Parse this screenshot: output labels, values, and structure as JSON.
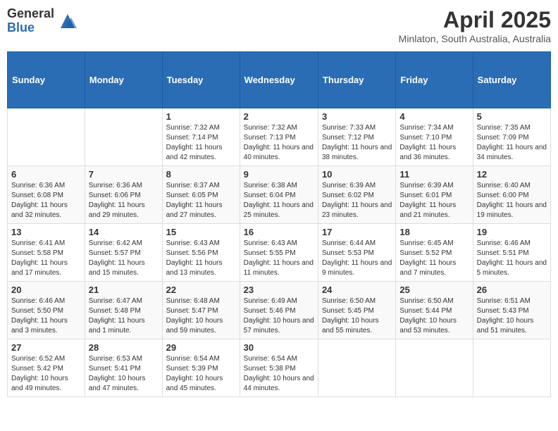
{
  "header": {
    "logo_general": "General",
    "logo_blue": "Blue",
    "title": "April 2025",
    "location": "Minlaton, South Australia, Australia"
  },
  "days_of_week": [
    "Sunday",
    "Monday",
    "Tuesday",
    "Wednesday",
    "Thursday",
    "Friday",
    "Saturday"
  ],
  "weeks": [
    [
      {
        "day": "",
        "sunrise": "",
        "sunset": "",
        "daylight": ""
      },
      {
        "day": "",
        "sunrise": "",
        "sunset": "",
        "daylight": ""
      },
      {
        "day": "1",
        "sunrise": "Sunrise: 7:32 AM",
        "sunset": "Sunset: 7:14 PM",
        "daylight": "Daylight: 11 hours and 42 minutes."
      },
      {
        "day": "2",
        "sunrise": "Sunrise: 7:32 AM",
        "sunset": "Sunset: 7:13 PM",
        "daylight": "Daylight: 11 hours and 40 minutes."
      },
      {
        "day": "3",
        "sunrise": "Sunrise: 7:33 AM",
        "sunset": "Sunset: 7:12 PM",
        "daylight": "Daylight: 11 hours and 38 minutes."
      },
      {
        "day": "4",
        "sunrise": "Sunrise: 7:34 AM",
        "sunset": "Sunset: 7:10 PM",
        "daylight": "Daylight: 11 hours and 36 minutes."
      },
      {
        "day": "5",
        "sunrise": "Sunrise: 7:35 AM",
        "sunset": "Sunset: 7:09 PM",
        "daylight": "Daylight: 11 hours and 34 minutes."
      }
    ],
    [
      {
        "day": "6",
        "sunrise": "Sunrise: 6:36 AM",
        "sunset": "Sunset: 6:08 PM",
        "daylight": "Daylight: 11 hours and 32 minutes."
      },
      {
        "day": "7",
        "sunrise": "Sunrise: 6:36 AM",
        "sunset": "Sunset: 6:06 PM",
        "daylight": "Daylight: 11 hours and 29 minutes."
      },
      {
        "day": "8",
        "sunrise": "Sunrise: 6:37 AM",
        "sunset": "Sunset: 6:05 PM",
        "daylight": "Daylight: 11 hours and 27 minutes."
      },
      {
        "day": "9",
        "sunrise": "Sunrise: 6:38 AM",
        "sunset": "Sunset: 6:04 PM",
        "daylight": "Daylight: 11 hours and 25 minutes."
      },
      {
        "day": "10",
        "sunrise": "Sunrise: 6:39 AM",
        "sunset": "Sunset: 6:02 PM",
        "daylight": "Daylight: 11 hours and 23 minutes."
      },
      {
        "day": "11",
        "sunrise": "Sunrise: 6:39 AM",
        "sunset": "Sunset: 6:01 PM",
        "daylight": "Daylight: 11 hours and 21 minutes."
      },
      {
        "day": "12",
        "sunrise": "Sunrise: 6:40 AM",
        "sunset": "Sunset: 6:00 PM",
        "daylight": "Daylight: 11 hours and 19 minutes."
      }
    ],
    [
      {
        "day": "13",
        "sunrise": "Sunrise: 6:41 AM",
        "sunset": "Sunset: 5:58 PM",
        "daylight": "Daylight: 11 hours and 17 minutes."
      },
      {
        "day": "14",
        "sunrise": "Sunrise: 6:42 AM",
        "sunset": "Sunset: 5:57 PM",
        "daylight": "Daylight: 11 hours and 15 minutes."
      },
      {
        "day": "15",
        "sunrise": "Sunrise: 6:43 AM",
        "sunset": "Sunset: 5:56 PM",
        "daylight": "Daylight: 11 hours and 13 minutes."
      },
      {
        "day": "16",
        "sunrise": "Sunrise: 6:43 AM",
        "sunset": "Sunset: 5:55 PM",
        "daylight": "Daylight: 11 hours and 11 minutes."
      },
      {
        "day": "17",
        "sunrise": "Sunrise: 6:44 AM",
        "sunset": "Sunset: 5:53 PM",
        "daylight": "Daylight: 11 hours and 9 minutes."
      },
      {
        "day": "18",
        "sunrise": "Sunrise: 6:45 AM",
        "sunset": "Sunset: 5:52 PM",
        "daylight": "Daylight: 11 hours and 7 minutes."
      },
      {
        "day": "19",
        "sunrise": "Sunrise: 6:46 AM",
        "sunset": "Sunset: 5:51 PM",
        "daylight": "Daylight: 11 hours and 5 minutes."
      }
    ],
    [
      {
        "day": "20",
        "sunrise": "Sunrise: 6:46 AM",
        "sunset": "Sunset: 5:50 PM",
        "daylight": "Daylight: 11 hours and 3 minutes."
      },
      {
        "day": "21",
        "sunrise": "Sunrise: 6:47 AM",
        "sunset": "Sunset: 5:48 PM",
        "daylight": "Daylight: 11 hours and 1 minute."
      },
      {
        "day": "22",
        "sunrise": "Sunrise: 6:48 AM",
        "sunset": "Sunset: 5:47 PM",
        "daylight": "Daylight: 10 hours and 59 minutes."
      },
      {
        "day": "23",
        "sunrise": "Sunrise: 6:49 AM",
        "sunset": "Sunset: 5:46 PM",
        "daylight": "Daylight: 10 hours and 57 minutes."
      },
      {
        "day": "24",
        "sunrise": "Sunrise: 6:50 AM",
        "sunset": "Sunset: 5:45 PM",
        "daylight": "Daylight: 10 hours and 55 minutes."
      },
      {
        "day": "25",
        "sunrise": "Sunrise: 6:50 AM",
        "sunset": "Sunset: 5:44 PM",
        "daylight": "Daylight: 10 hours and 53 minutes."
      },
      {
        "day": "26",
        "sunrise": "Sunrise: 6:51 AM",
        "sunset": "Sunset: 5:43 PM",
        "daylight": "Daylight: 10 hours and 51 minutes."
      }
    ],
    [
      {
        "day": "27",
        "sunrise": "Sunrise: 6:52 AM",
        "sunset": "Sunset: 5:42 PM",
        "daylight": "Daylight: 10 hours and 49 minutes."
      },
      {
        "day": "28",
        "sunrise": "Sunrise: 6:53 AM",
        "sunset": "Sunset: 5:41 PM",
        "daylight": "Daylight: 10 hours and 47 minutes."
      },
      {
        "day": "29",
        "sunrise": "Sunrise: 6:54 AM",
        "sunset": "Sunset: 5:39 PM",
        "daylight": "Daylight: 10 hours and 45 minutes."
      },
      {
        "day": "30",
        "sunrise": "Sunrise: 6:54 AM",
        "sunset": "Sunset: 5:38 PM",
        "daylight": "Daylight: 10 hours and 44 minutes."
      },
      {
        "day": "",
        "sunrise": "",
        "sunset": "",
        "daylight": ""
      },
      {
        "day": "",
        "sunrise": "",
        "sunset": "",
        "daylight": ""
      },
      {
        "day": "",
        "sunrise": "",
        "sunset": "",
        "daylight": ""
      }
    ]
  ]
}
